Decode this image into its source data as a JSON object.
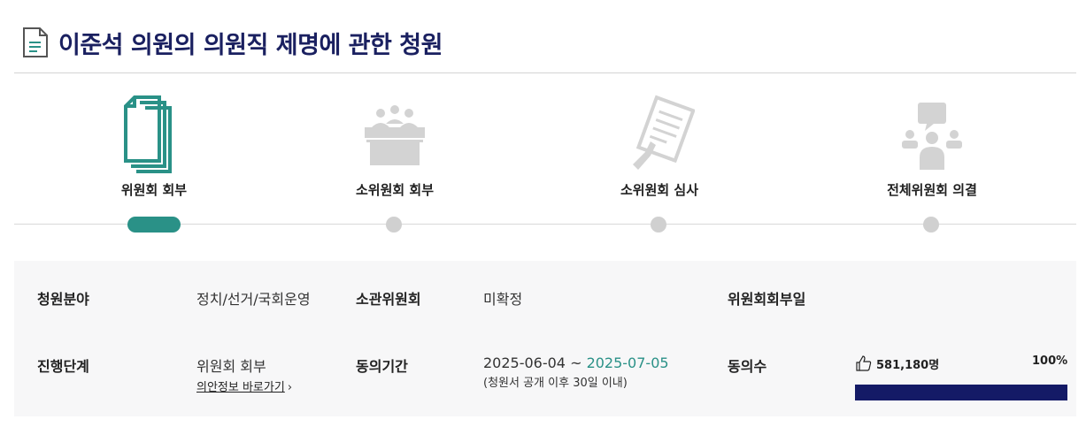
{
  "page": {
    "title": "이준석 의원의 의원직 제명에 관한 청원",
    "title_icon": "document-icon",
    "accent_color": "#2a9187",
    "title_color": "#1a2060"
  },
  "steps": [
    {
      "label": "위원회 회부",
      "icon": "documents-icon",
      "active": true
    },
    {
      "label": "소위원회 회부",
      "icon": "meeting-icon",
      "active": false
    },
    {
      "label": "소위원회 심사",
      "icon": "review-icon",
      "active": false
    },
    {
      "label": "전체위원회 의결",
      "icon": "discussion-icon",
      "active": false
    }
  ],
  "info": {
    "field_label": "청원분야",
    "field_value": "정치/선거/국회운영",
    "committee_label": "소관위원회",
    "committee_value": "미확정",
    "referral_date_label": "위원회회부일",
    "stage_label": "진행단계",
    "stage_value": "위원회 회부",
    "bill_link": "의안정보 바로가기",
    "bill_link_arrow": "›",
    "period_label": "동의기간",
    "period_start": "2025-06-04",
    "period_sep": " ~ ",
    "period_end": "2025-07-05",
    "period_note": "(청원서 공개 이후 30일 이내)",
    "agree_label": "동의수",
    "agree_count": "581,180명",
    "agree_percent": "100%",
    "agree_fraction": 1.0,
    "bar_color": "#141a66"
  }
}
